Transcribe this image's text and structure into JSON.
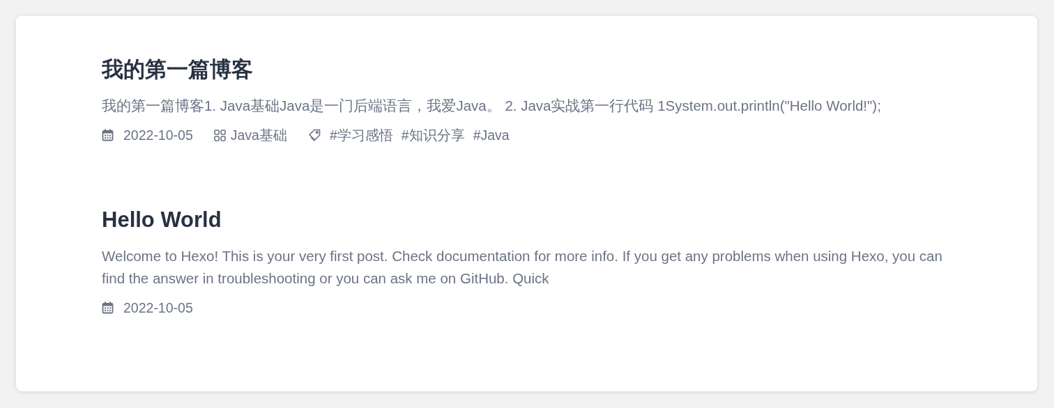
{
  "posts": [
    {
      "title": "我的第一篇博客",
      "excerpt": "我的第一篇博客1. Java基础Java是一门后端语言，我爱Java。 2. Java实战第一行代码 1System.out.println(\"Hello World!\");",
      "date": "2022-10-05",
      "category": "Java基础",
      "tags": [
        "#学习感悟",
        "#知识分享",
        "#Java"
      ]
    },
    {
      "title": "Hello World",
      "excerpt": "Welcome to Hexo! This is your very first post. Check documentation for more info. If you get any problems when using Hexo, you can find the answer in troubleshooting or you can ask me on GitHub. Quick",
      "date": "2022-10-05"
    }
  ]
}
